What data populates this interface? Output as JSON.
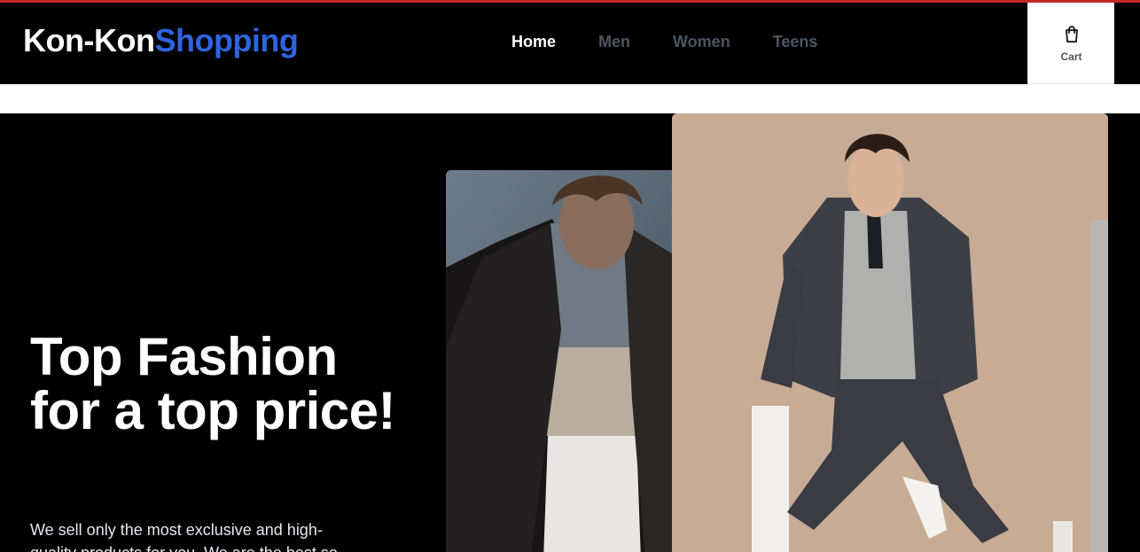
{
  "brand": {
    "part1": "Kon-Kon",
    "part2": "Shopping"
  },
  "nav": {
    "items": [
      {
        "label": "Home",
        "active": true
      },
      {
        "label": "Men",
        "active": false
      },
      {
        "label": "Women",
        "active": false
      },
      {
        "label": "Teens",
        "active": false
      }
    ]
  },
  "cart": {
    "label": "Cart",
    "icon": "shopping-bag-icon"
  },
  "hero": {
    "headline": "Top Fashion for a top price!",
    "subtext": "We sell only the most exclusive and high-quality products for you. We are the best so"
  },
  "colors": {
    "brand_blue": "#2f64e0",
    "accent_red": "#c62828",
    "background": "#000000"
  }
}
